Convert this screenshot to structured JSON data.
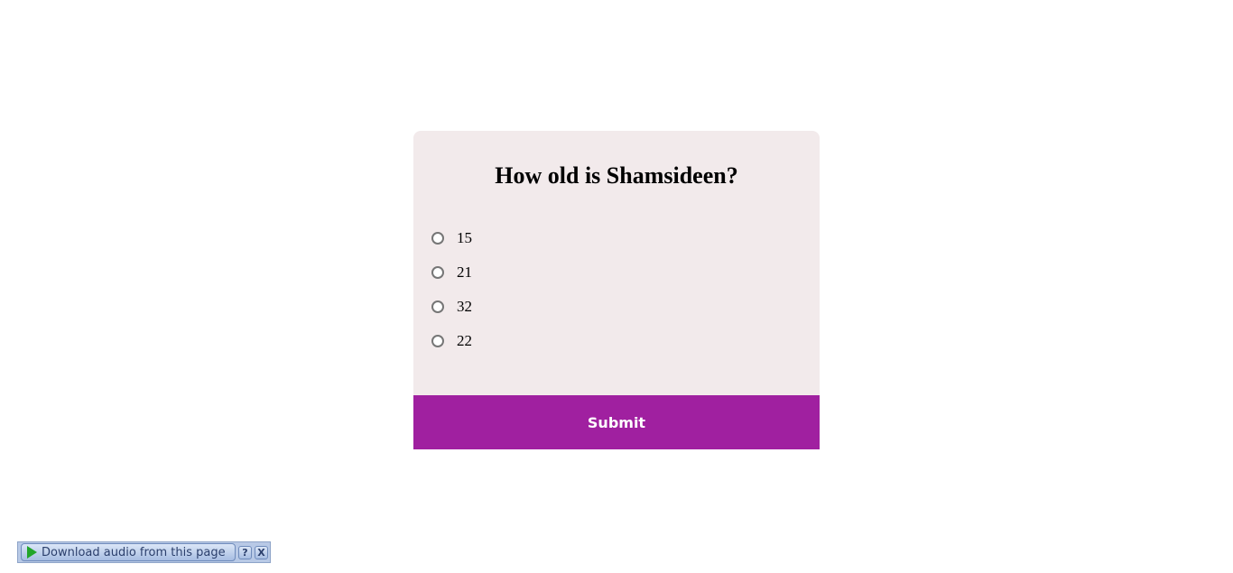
{
  "quiz": {
    "question": "How old is Shamsideen?",
    "options": [
      {
        "label": "15"
      },
      {
        "label": "21"
      },
      {
        "label": "32"
      },
      {
        "label": "22"
      }
    ],
    "submit_label": "Submit",
    "colors": {
      "card_background": "#f2eaeb",
      "submit_background": "#a020a0",
      "submit_text": "#ffffff"
    }
  },
  "audio_toolbar": {
    "download_label": "Download audio from this page",
    "help_label": "?",
    "close_label": "X",
    "icons": [
      "play-icon",
      "help-icon",
      "close-icon"
    ]
  }
}
